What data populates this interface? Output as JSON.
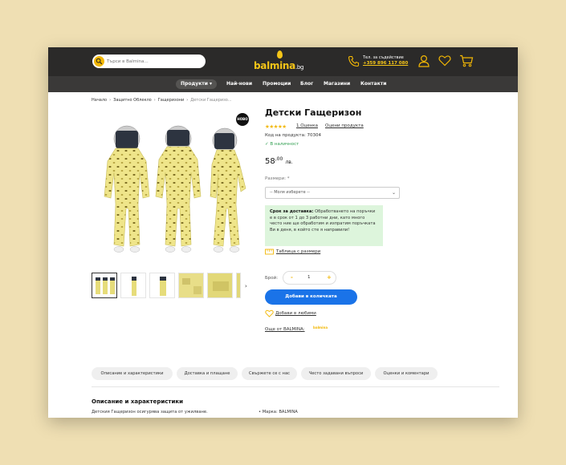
{
  "header": {
    "search_placeholder": "Търси в Balmina...",
    "logo_text": "balmina",
    "logo_tld": ".bg",
    "phone_label": "Тел. за съдействие",
    "phone_number": "+359 896 117 080"
  },
  "nav": {
    "items": [
      "Продукти",
      "Най-нови",
      "Промоции",
      "Блог",
      "Магазини",
      "Контакти"
    ]
  },
  "breadcrumb": {
    "items": [
      "Начало",
      "Защитно Облекло",
      "Гащеризони",
      "Детски Гащеризо..."
    ]
  },
  "product": {
    "badge": "НОВО",
    "title": "Детски Гащеризон",
    "stars": "★★★★★",
    "review_count": "1 Оценка",
    "rate_link": "Оцени продукта",
    "code": "Код на продукта: 70304",
    "stock": "✓ В наличност",
    "price_main": "58",
    "price_cents": ",00",
    "currency": "лв.",
    "size_label": "Размери: *",
    "size_select": "-- Моля изберете --",
    "delivery_bold": "Срок за доставка:",
    "delivery_text": " Обработването на поръчки е в срок от 1 до 3 работни дни, като много често ние ще обработим и изпратим поръчката Ви в деня, в който сте я направили!",
    "size_table": "Таблица с размери",
    "qty_label": "Брой:",
    "qty_minus": "-",
    "qty_value": "1",
    "qty_plus": "+",
    "add_to_cart": "Добави в количката",
    "favorites": "Добави в любими",
    "more_from": "Още от BALMINA:",
    "more_logo": "balmina"
  },
  "tabs": {
    "items": [
      "Описание и характеристики",
      "Доставка и плащане",
      "Свържете се с нас",
      "Често задавани въпроси",
      "Оценки и коментари"
    ]
  },
  "description": {
    "title": "Описание и характеристики",
    "text": "Детския Гащеризон осигурява защита от ужилване.",
    "brand": "• Марка: BALMINA"
  },
  "colors": {
    "background": "#efdfb3",
    "header": "#2b2a29",
    "navbar": "#3a3938",
    "accent": "#f2b705",
    "cta": "#1a73e8",
    "delivery_bg": "#ddf5dc",
    "stock": "#2e9e4f"
  },
  "icons": [
    "search-icon",
    "phone-icon",
    "user-icon",
    "heart-icon",
    "cart-icon",
    "chevron-down-icon",
    "ruler-icon",
    "chevron-right-icon"
  ]
}
